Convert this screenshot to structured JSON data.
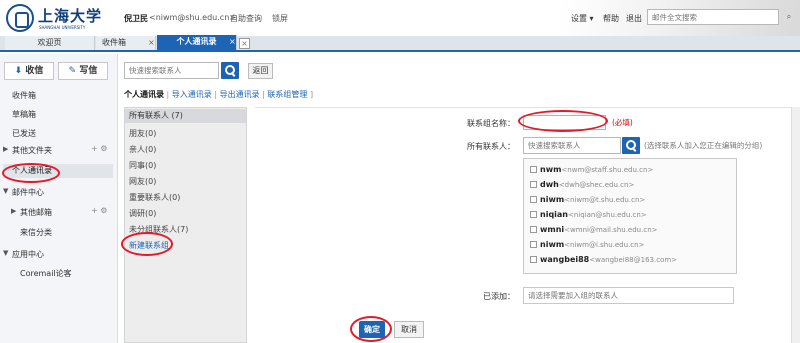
{
  "header": {
    "logo_text": "上海大学",
    "logo_sub": "SHANGHAI UNIVERSITY",
    "user_name": "倪卫民",
    "user_email": "<niwm@shu.edu.cn>",
    "self_query": "自助查询",
    "lock_screen": "锁屏",
    "settings": "设置 ▾",
    "help": "帮助",
    "logout": "退出",
    "search_placeholder": "邮件全文搜索"
  },
  "tabs": {
    "welcome": "欢迎页",
    "inbox": "收件箱",
    "contacts": "个人通讯录",
    "close": "×"
  },
  "sidebar": {
    "receive": "收信",
    "compose": "写信",
    "inbox": "收件箱",
    "drafts": "草稿箱",
    "sent": "已发送",
    "other_folders": "其他文件夹",
    "contacts": "个人通讯录",
    "mail_center": "邮件中心",
    "other_mailbox": "其他邮箱",
    "incoming_classify": "来信分类",
    "app_center": "应用中心",
    "coremail_forum": "Coremail论客"
  },
  "toolbar": {
    "search_placeholder": "快速搜索联系人",
    "return": "返回"
  },
  "crumbs": {
    "title": "个人通讯录",
    "import": "导入通讯录",
    "export": "导出通讯录",
    "group_manage": "联系组管理"
  },
  "groups": [
    "所有联系人 (7)",
    "朋友(0)",
    "亲人(0)",
    "同事(0)",
    "网友(0)",
    "重要联系人(0)",
    "调研(0)",
    "未分组联系人(7)",
    "新建联系组"
  ],
  "form": {
    "name_label": "联系组名称：",
    "required": "(必填)",
    "all_contacts_label": "所有联系人：",
    "contact_search_placeholder": "快速搜索联系人",
    "hint": "(选择联系人加入您正在编辑的分组)",
    "added_label": "已添加：",
    "added_placeholder": "请选择需要加入组的联系人",
    "confirm": "确定",
    "cancel": "取消"
  },
  "contacts": [
    {
      "name": "nwm",
      "email": "<nwm@staff.shu.edu.cn>"
    },
    {
      "name": "dwh",
      "email": "<dwh@shec.edu.cn>"
    },
    {
      "name": "niwm",
      "email": "<niwm@t.shu.edu.cn>"
    },
    {
      "name": "niqian",
      "email": "<niqian@shu.edu.cn>"
    },
    {
      "name": "wmni",
      "email": "<wmni@mail.shu.edu.cn>"
    },
    {
      "name": "niwm",
      "email": "<niwm@i.shu.edu.cn>"
    },
    {
      "name": "wangbei88",
      "email": "<wangbei88@163.com>"
    }
  ],
  "colors": {
    "accent": "#1d64b5",
    "annotation": "#e21b2a",
    "required": "#dd0000"
  }
}
